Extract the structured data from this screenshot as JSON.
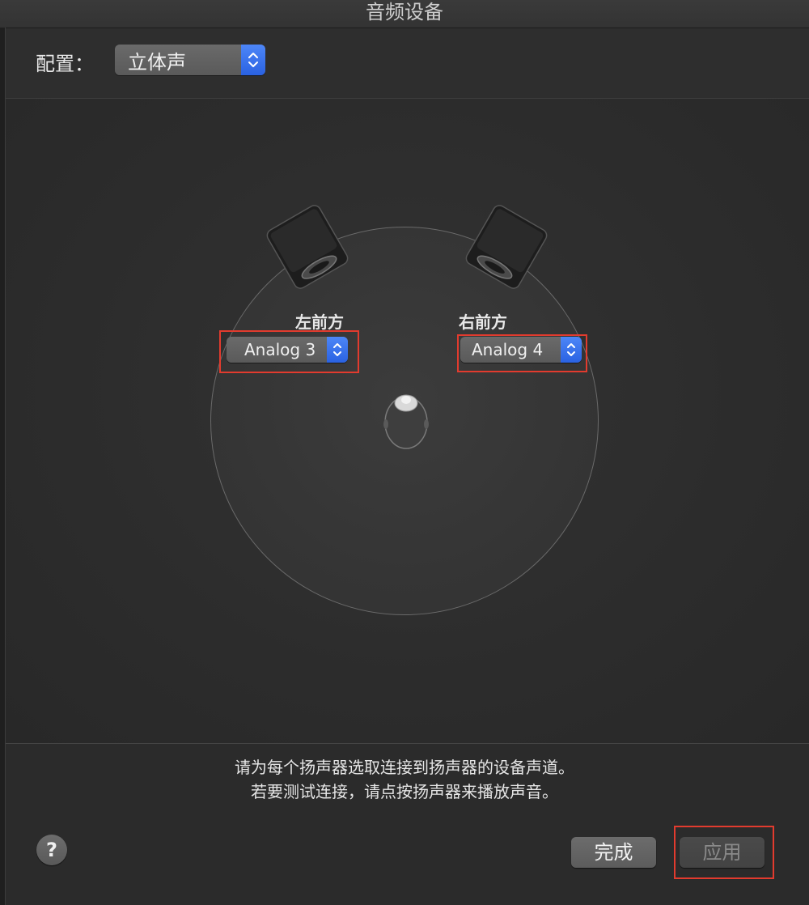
{
  "window": {
    "title": "音频设备"
  },
  "config": {
    "label": "配置：",
    "selected": "立体声"
  },
  "speakers": {
    "left": {
      "label": "左前方",
      "channel": "Analog 3"
    },
    "right": {
      "label": "右前方",
      "channel": "Analog 4"
    }
  },
  "instructions": {
    "line1": "请为每个扬声器选取连接到扬声器的设备声道。",
    "line2": "若要测试连接，请点按扬声器来播放声音。"
  },
  "buttons": {
    "help": "?",
    "done": "完成",
    "apply": "应用"
  },
  "colors": {
    "accent": "#2f6be6",
    "highlight_box": "#e23b2e",
    "background": "#2b2b2b"
  }
}
